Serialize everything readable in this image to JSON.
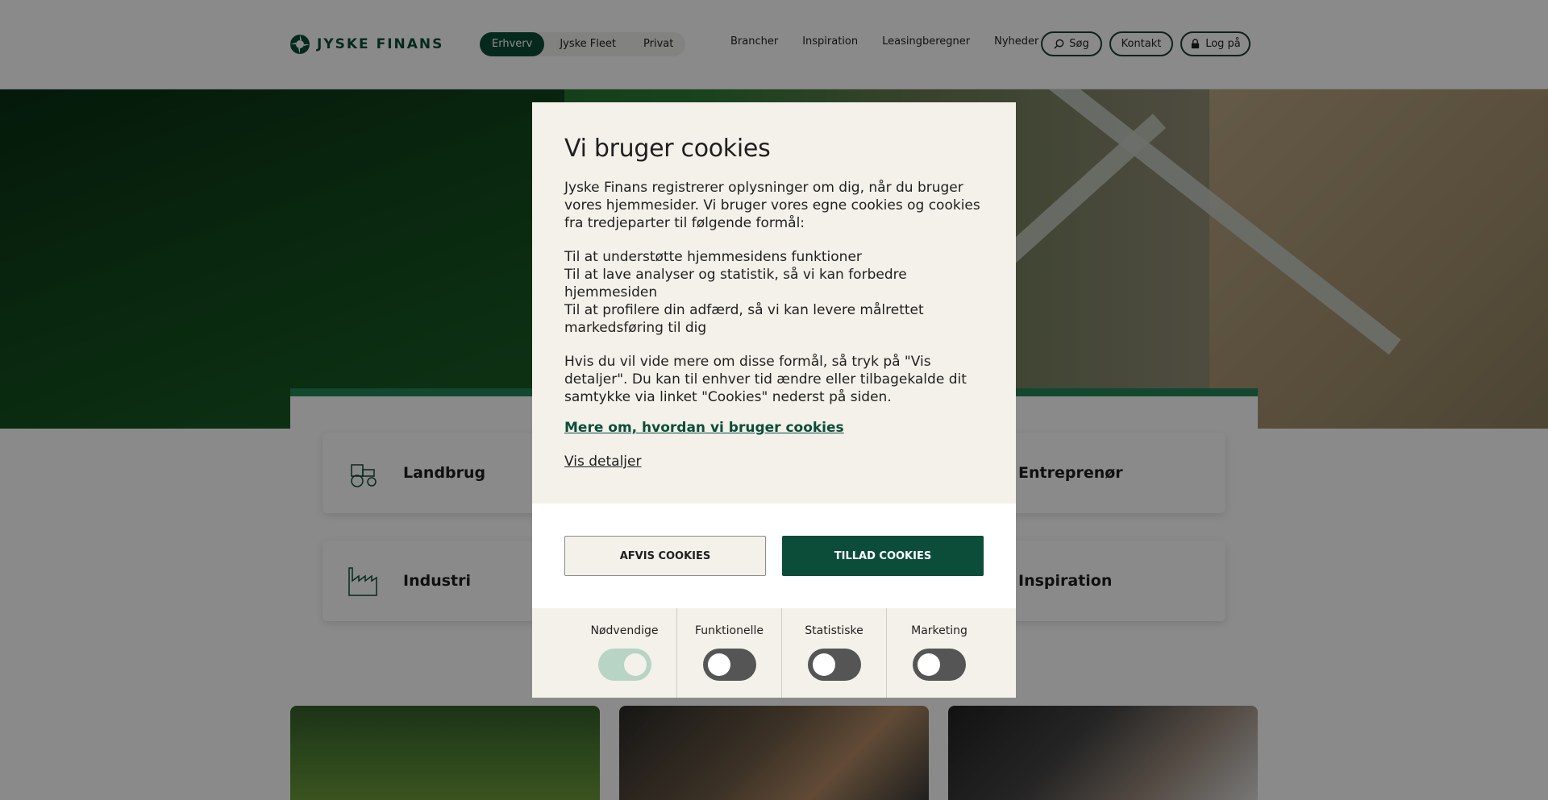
{
  "header": {
    "brand": "JYSKE FINANS",
    "segments": [
      {
        "label": "Erhverv",
        "active": true
      },
      {
        "label": "Jyske Fleet",
        "active": false
      },
      {
        "label": "Privat",
        "active": false
      }
    ],
    "nav": [
      "Brancher",
      "Inspiration",
      "Leasingberegner",
      "Nyheder"
    ],
    "search_label": "Søg",
    "contact_label": "Kontakt",
    "login_label": "Log på"
  },
  "categories": [
    {
      "label": "Landbrug",
      "icon": "tractor-icon"
    },
    {
      "label": "Entreprenør",
      "icon": "excavator-icon"
    },
    {
      "label": "Industri",
      "icon": "factory-icon"
    },
    {
      "label": "Inspiration",
      "icon": "lightbulb-icon"
    }
  ],
  "cookie_dialog": {
    "title": "Vi bruger cookies",
    "intro": "Jyske Finans registrerer oplysninger om dig, når du bruger vores hjemmesider. Vi bruger vores egne cookies og cookies fra tredjeparter til følgende formål:",
    "purposes": [
      "Til at understøtte hjemmesidens funktioner",
      "Til at lave analyser og statistik, så vi kan forbedre hjemmesiden",
      "Til at profilere din adfærd, så vi kan levere målrettet markedsføring til dig"
    ],
    "details_text": "Hvis du vil vide mere om disse formål, så tryk på \"Vis detaljer\". Du kan til enhver tid ændre eller tilbagekalde dit samtykke via linket \"Cookies\" nederst på siden.",
    "more_link": "Mere om, hvordan vi bruger cookies",
    "details_link": "Vis detaljer",
    "reject_label": "AFVIS COOKIES",
    "accept_label": "TILLAD COOKIES",
    "toggles": [
      {
        "label": "Nødvendige",
        "state": "on",
        "disabled": true
      },
      {
        "label": "Funktionelle",
        "state": "off"
      },
      {
        "label": "Statistiske",
        "state": "off"
      },
      {
        "label": "Marketing",
        "state": "off"
      }
    ]
  },
  "colors": {
    "brand_green": "#0c4d39",
    "accent_green": "#23855a",
    "dialog_bg": "#f3f1ea"
  }
}
